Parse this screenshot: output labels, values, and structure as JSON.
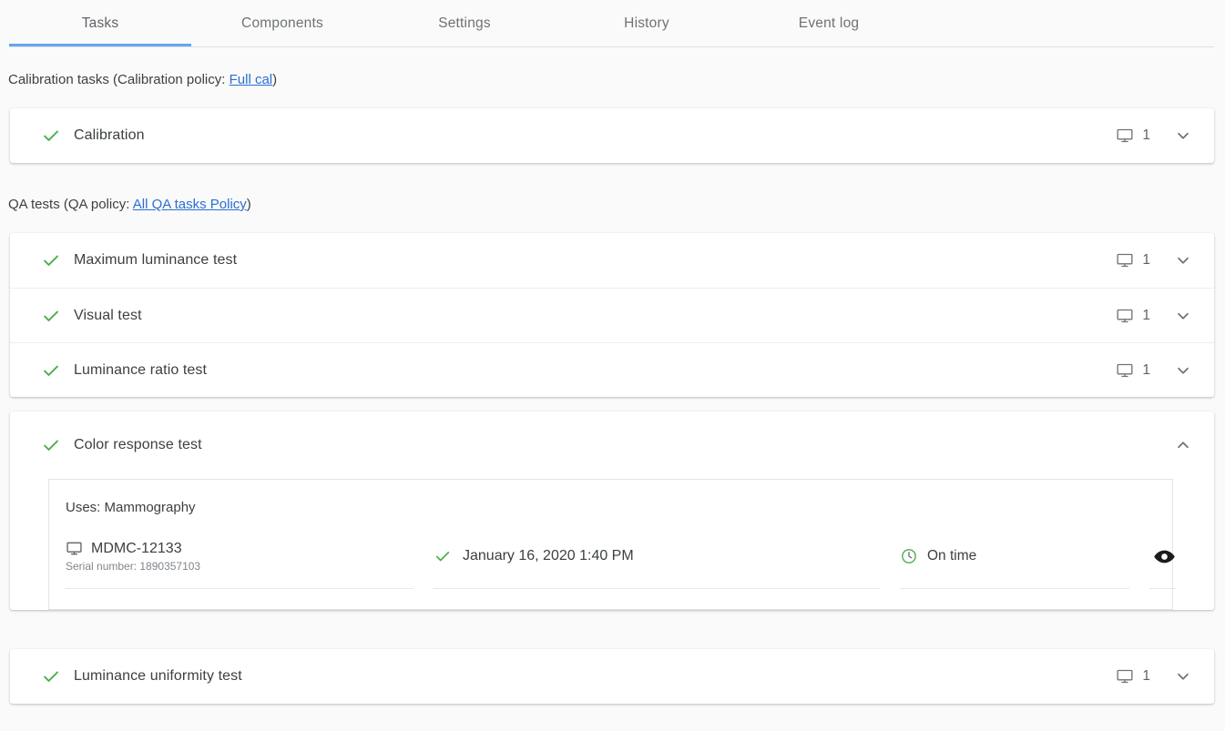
{
  "tabs": [
    {
      "label": "Tasks",
      "active": true
    },
    {
      "label": "Components",
      "active": false
    },
    {
      "label": "Settings",
      "active": false
    },
    {
      "label": "History",
      "active": false
    },
    {
      "label": "Event log",
      "active": false
    }
  ],
  "calibration_section": {
    "prefix": "Calibration tasks (Calibration policy: ",
    "policy_link": "Full cal",
    "suffix": ")",
    "tasks": [
      {
        "label": "Calibration",
        "status": "passed",
        "device_count": "1",
        "expanded": false
      }
    ]
  },
  "qa_section": {
    "prefix": "QA tests (QA policy: ",
    "policy_link": "All QA tasks Policy",
    "suffix": ")",
    "group_one": [
      {
        "label": "Maximum luminance test",
        "status": "passed",
        "device_count": "1",
        "expanded": false
      },
      {
        "label": "Visual test",
        "status": "passed",
        "device_count": "1",
        "expanded": false
      },
      {
        "label": "Luminance ratio test",
        "status": "passed",
        "device_count": "1",
        "expanded": false
      }
    ],
    "expanded_task": {
      "label": "Color response test",
      "status": "passed",
      "expanded": true,
      "uses_label": "Uses: Mammography",
      "detail": {
        "device_name": "MDMC-12133",
        "serial_label": "Serial number: 1890357103",
        "date": "January 16, 2020 1:40 PM",
        "date_status": "passed",
        "timeliness": "On time",
        "view_action": "view-details"
      }
    },
    "group_two": [
      {
        "label": "Luminance uniformity test",
        "status": "passed",
        "device_count": "1",
        "expanded": false
      }
    ]
  },
  "icons": {
    "check": "check-icon",
    "monitor": "monitor-icon",
    "chevron_down": "chevron-down-icon",
    "chevron_up": "chevron-up-icon",
    "clock": "clock-icon",
    "eye": "eye-icon"
  },
  "colors": {
    "accent_blue": "#64a7f0",
    "link_blue": "#2a6fd4",
    "success_green": "#4caf50",
    "page_bg": "#fafafa",
    "card_bg": "#ffffff",
    "text_primary": "#3c4043",
    "text_secondary": "#80868b"
  }
}
